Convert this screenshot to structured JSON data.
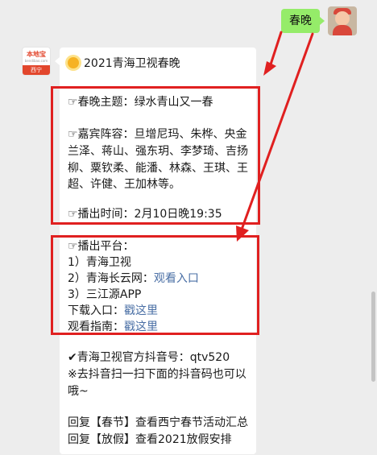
{
  "outgoing": {
    "text": "春晚",
    "avatar_icon": "cartoon-avatar-icon"
  },
  "account": {
    "avatar_icon": "official-account-logo-icon",
    "logo_text": "西宁"
  },
  "message": {
    "title": "2021青海卫视春晚",
    "title_icon": "sun-icon",
    "theme_label": "☞春晚主题：",
    "theme_value": "绿水青山又一春",
    "guests_lines": [
      "☞嘉宾阵容：旦增尼玛、朱桦、央金",
      "兰泽、蒋山、强东玥、李梦琦、吉扬",
      "柳、粟钦柔、能潘、林森、王琪、王",
      "超、许健、王加林等。"
    ],
    "airtime": "☞播出时间：2月10日晚19:35",
    "platform_label": "☞播出平台：",
    "platforms": {
      "p1": "1）青海卫视",
      "p2_prefix": "2）青海长云网：",
      "p2_link": "观看入口",
      "p3": "3）三江源APP"
    },
    "download_prefix": "下载入口：",
    "download_link": "戳这里",
    "guide_prefix": "观看指南：",
    "guide_link": "戳这里",
    "douyin_line1": "✔青海卫视官方抖音号：qtv520",
    "douyin_line2": "※去抖音扫一扫下面的抖音码也可以",
    "douyin_line3": "哦~",
    "reply1": "回复【春节】查看西宁春节活动汇总",
    "reply2": "回复【放假】查看2021放假安排"
  },
  "colors": {
    "highlight": "#e02020",
    "link": "#4a6fa5",
    "outgoing_bubble": "#95ec69",
    "background": "#ededed"
  }
}
